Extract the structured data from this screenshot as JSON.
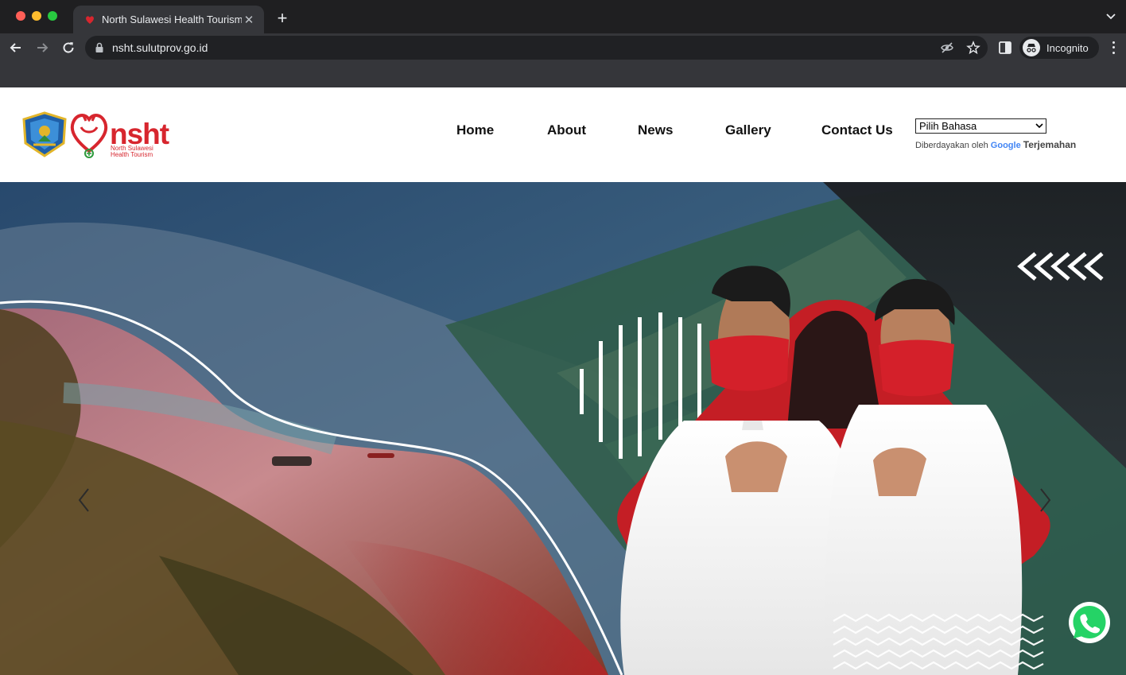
{
  "browser": {
    "tab_title": "North Sulawesi Health Tourism",
    "url": "nsht.sulutprov.go.id",
    "profile_label": "Incognito"
  },
  "site": {
    "logo_word": "nsht",
    "logo_sub_line1": "North Sulawesi",
    "logo_sub_line2": "Health Tourism",
    "nav": [
      "Home",
      "About",
      "News",
      "Gallery",
      "Contact Us"
    ],
    "language_select": "Pilih Bahasa",
    "powered_prefix": "Diberdayakan oleh",
    "powered_brand": "Google",
    "powered_suffix": "Terjemahan"
  },
  "colors": {
    "brand_red": "#d7262e",
    "chrome_dark": "#202124",
    "chrome_mid": "#35363a"
  },
  "hero": {
    "prev_icon": "chevron-left-icon",
    "next_icon": "chevron-right-icon",
    "whatsapp_icon": "whatsapp-icon"
  }
}
